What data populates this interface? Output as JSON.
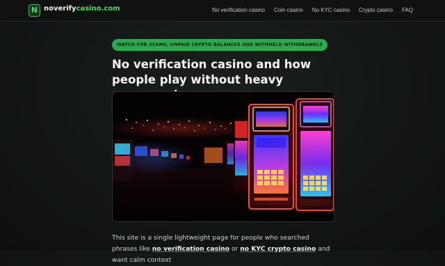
{
  "site": {
    "logo_letter": "N",
    "logo_part1": "noverify",
    "logo_part2": "casino.com",
    "accent": "#3fdc6e"
  },
  "nav": {
    "items": [
      {
        "label": "No verification casino"
      },
      {
        "label": "Coin casino"
      },
      {
        "label": "No KYC casino"
      },
      {
        "label": "Crypto casino"
      },
      {
        "label": "FAQ"
      }
    ]
  },
  "main": {
    "alert_label": "WATCH FOR SCAMS, UNPAID CRYPTO BALANCES AND WITHHELD WITHDRAWALS",
    "title": "No verification casino and how people play without heavy paperwork",
    "hero_icon": "slot-machines-photo",
    "intro": {
      "text1": "This site is a single lightweight page for people who searched phrases like",
      "term1": "no verification casino",
      "text2": "or",
      "term2": "no KYC crypto casino",
      "text3": "and want calm context"
    }
  }
}
